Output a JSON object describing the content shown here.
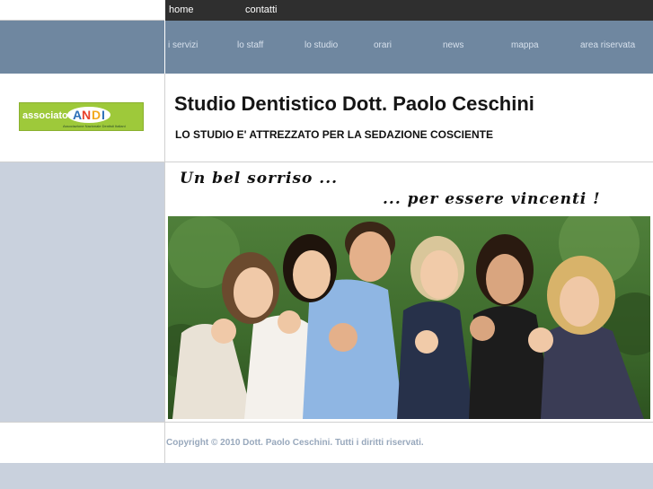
{
  "top_nav": {
    "items": [
      "home",
      "contatti"
    ]
  },
  "main_nav": {
    "items": [
      "i servizi",
      "lo staff",
      "lo studio",
      "orari",
      "news",
      "mappa",
      "area riservata"
    ]
  },
  "logo": {
    "prefix": "associato",
    "mark": "ANDI",
    "subtitle": "Associazione Nazionale Dentisti Italiani"
  },
  "header": {
    "title": "Studio Dentistico Dott. Paolo Ceschini",
    "subtitle": "LO STUDIO E' ATTREZZATO PER LA SEDAZIONE COSCIENTE"
  },
  "banner": {
    "slogan_line1": "Un bel sorriso ...",
    "slogan_line2": "... per essere vincenti !"
  },
  "footer": {
    "copyright": "Copyright © 2010 Dott. Paolo Ceschini. Tutti i diritti riservati."
  },
  "colors": {
    "top_bar": "#2f2f2f",
    "nav_bar": "#6f87a0",
    "side_bg": "#c9d1dd",
    "logo_green": "#9ec93a",
    "copyright": "#98a8bc"
  }
}
